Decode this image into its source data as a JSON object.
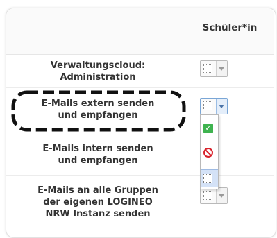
{
  "table": {
    "column_header": "Schüler*in",
    "rows": [
      {
        "label_line1": "Verwaltungscloud:",
        "label_line2": "Administration",
        "selected": "not-set"
      },
      {
        "label_line1": "E-Mails extern senden",
        "label_line2": "und empfangen",
        "selected": "not-set",
        "highlighted": true,
        "dropdown_open": true
      },
      {
        "label_line1": "E-Mails intern senden",
        "label_line2": "und empfangen",
        "selected": "not-set"
      },
      {
        "label_line1": "E-Mails an alle Gruppen",
        "label_line2": "der eigenen LOGINEO",
        "label_line3": "NRW Instanz senden",
        "selected": "not-set"
      }
    ]
  },
  "dropdown": {
    "options": [
      {
        "icon": "check-icon",
        "state": "allowed"
      },
      {
        "icon": "deny-icon",
        "state": "denied"
      },
      {
        "icon": "empty-box-icon",
        "state": "not-set",
        "highlighted": true
      }
    ]
  },
  "colors": {
    "highlight_outline": "#111111",
    "allowed": "#3fb34f",
    "denied": "#d8222b",
    "selection_highlight": "#d4e2f7"
  }
}
